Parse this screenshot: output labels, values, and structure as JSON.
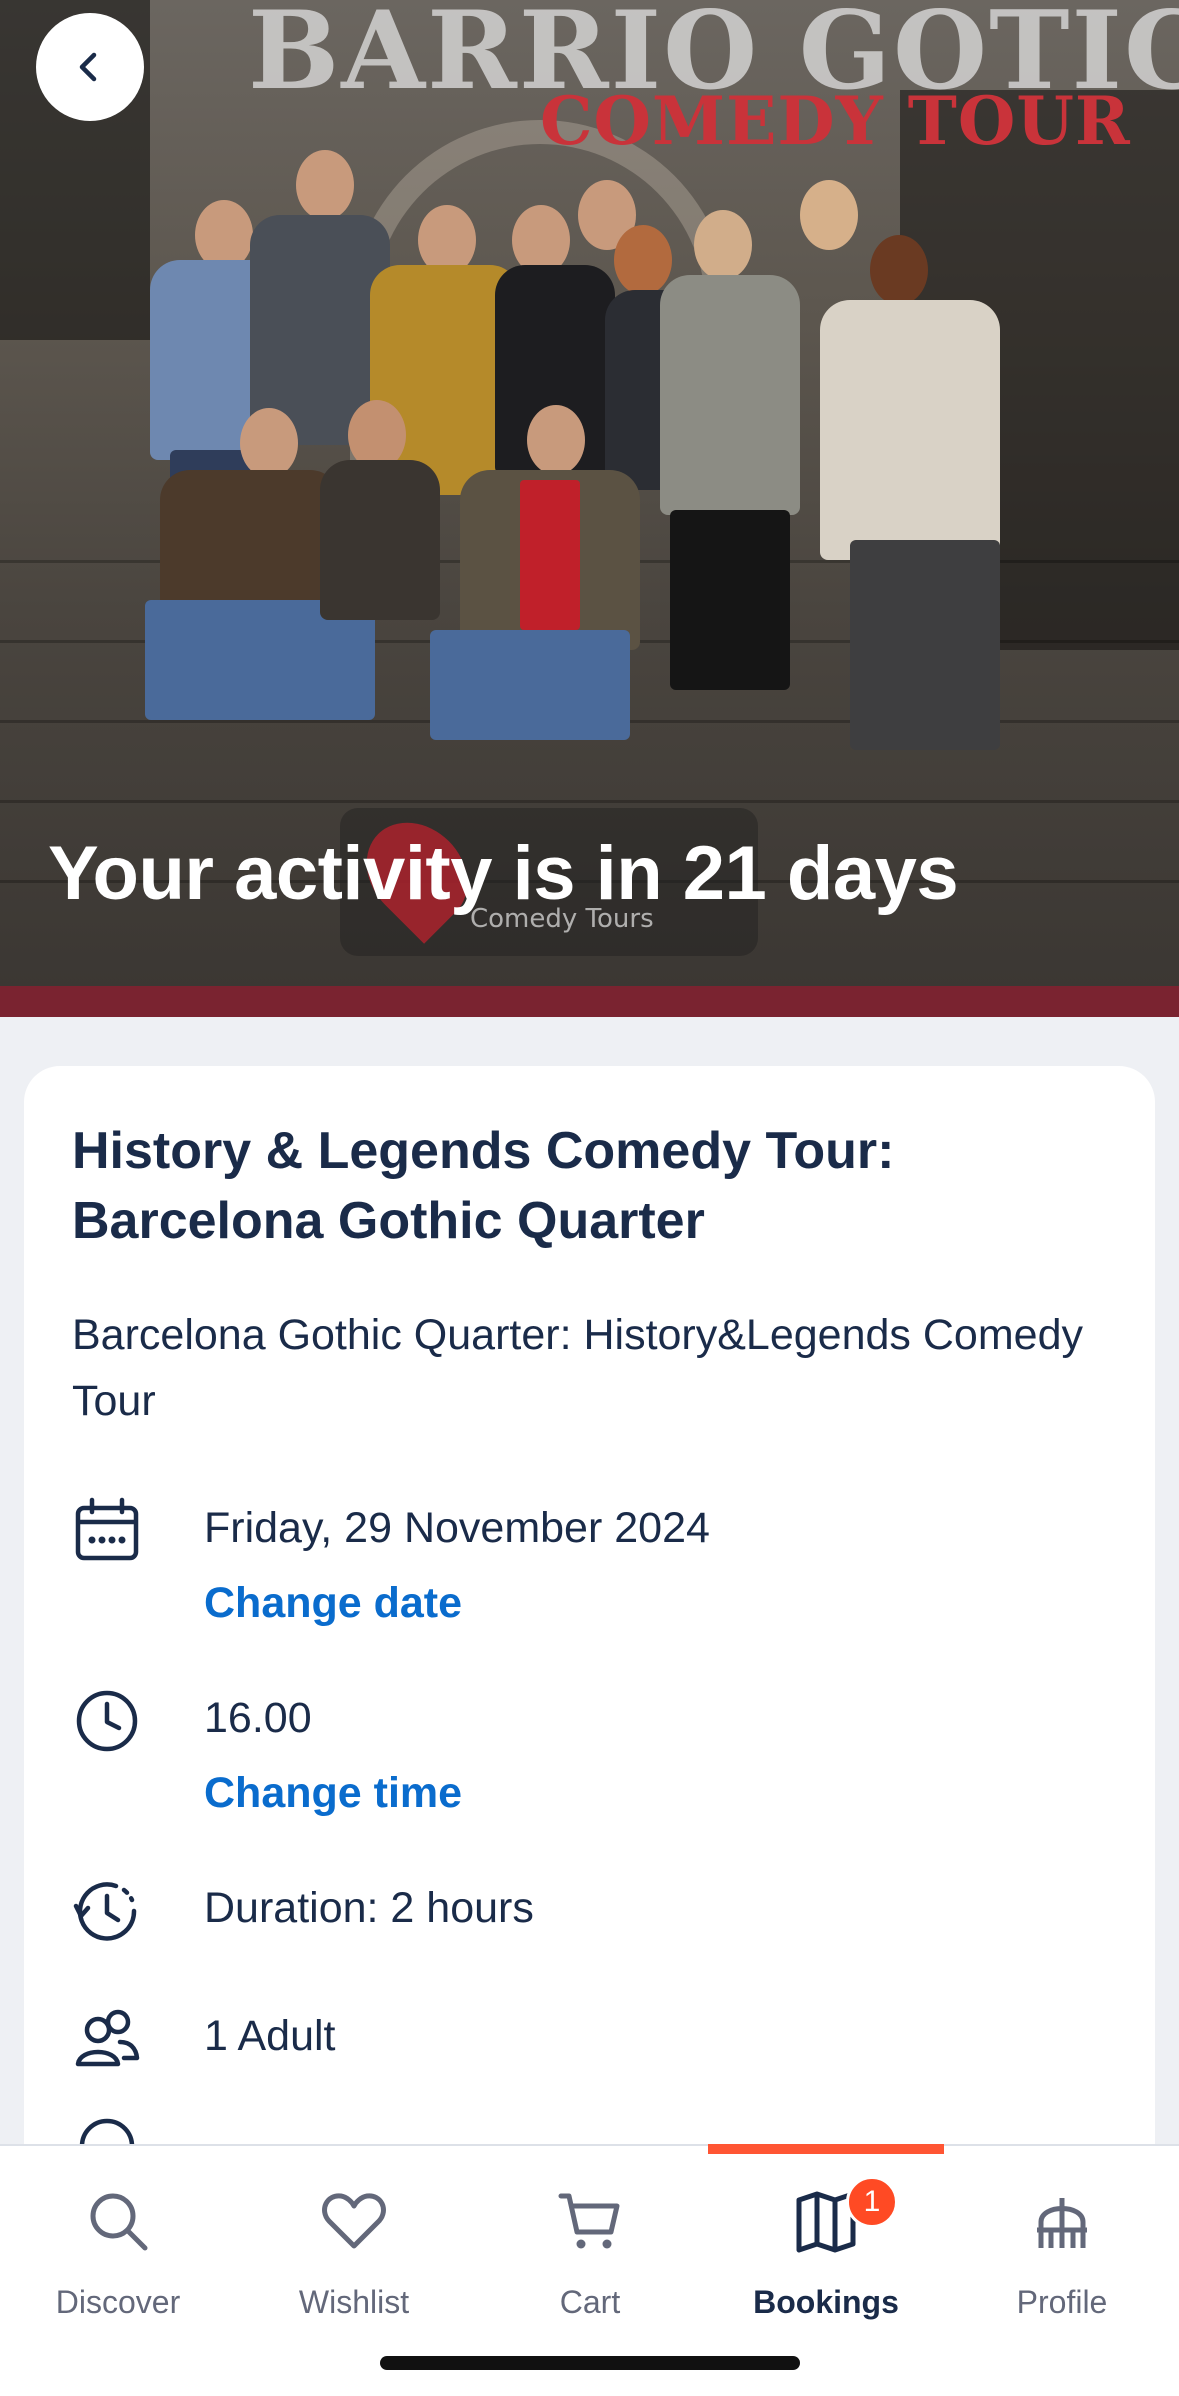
{
  "hero": {
    "sign_title": "BARRIO GOTICO",
    "sign_subtitle": "COMEDY TOUR",
    "watermark_text": "Comedy Tours",
    "countdown_text": "Your activity is in 21 days"
  },
  "activity": {
    "title": "History & Legends Comedy Tour: Barcelona Gothic Quarter",
    "option_name": "Barcelona Gothic Quarter: History&Legends Comedy Tour",
    "date": "Friday, 29 November 2024",
    "change_date_label": "Change date",
    "time": "16.00",
    "change_time_label": "Change time",
    "duration": "Duration: 2 hours",
    "participants": "1 Adult"
  },
  "nav": {
    "items": [
      {
        "label": "Discover",
        "icon": "search-icon"
      },
      {
        "label": "Wishlist",
        "icon": "heart-icon"
      },
      {
        "label": "Cart",
        "icon": "cart-icon"
      },
      {
        "label": "Bookings",
        "icon": "bookings-icon",
        "badge": "1",
        "active": true
      },
      {
        "label": "Profile",
        "icon": "profile-icon"
      }
    ]
  },
  "colors": {
    "accent_link": "#0a6ccd",
    "active_indicator": "#ff5533",
    "badge": "#ff4a24",
    "text_primary": "#1a2b49"
  }
}
